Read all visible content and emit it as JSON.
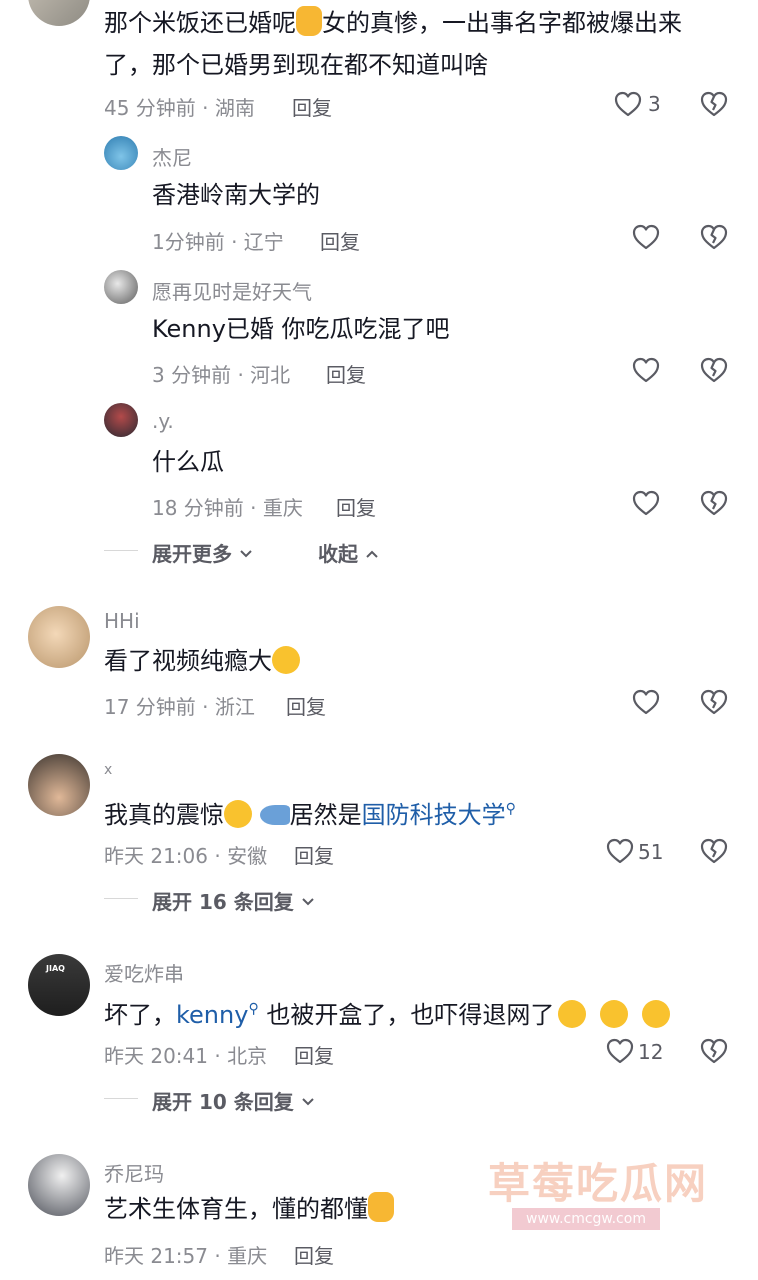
{
  "comments": [
    {
      "text_line1": "那个米饭还已婚呢",
      "text_line1b": "女的真惨，一出事名字都被爆出来",
      "text_line2": "了，那个已婚男到现在都不知道叫啥",
      "meta": "45 分钟前 · 湖南",
      "reply": "回复",
      "likes": "3"
    },
    {
      "name": "HHi",
      "text": "看了视频纯瘾大",
      "meta": "17 分钟前 · 浙江",
      "reply": "回复"
    },
    {
      "name": "x",
      "text_a": "我真的震惊",
      "text_b": "居然是",
      "link": "国防科技大学",
      "meta": "昨天 21:06 · 安徽",
      "reply": "回复",
      "likes": "51",
      "expand": "展开 16 条回复"
    },
    {
      "name": "爱吃炸串",
      "avatar_text": "JIAQ",
      "text_a": "坏了，",
      "link": "kenny",
      "text_b": " 也被开盒了，也吓得退网了",
      "meta": "昨天 20:41 · 北京",
      "reply": "回复",
      "likes": "12",
      "expand": "展开 10 条回复"
    },
    {
      "name": "乔尼玛",
      "text": "艺术生体育生，懂的都懂",
      "meta": "昨天 21:57 · 重庆",
      "reply": "回复"
    }
  ],
  "replies": [
    {
      "name": "杰尼",
      "text": "香港岭南大学的",
      "meta": "1分钟前 · 辽宁",
      "reply": "回复"
    },
    {
      "name": "愿再见时是好天气",
      "text": "Kenny已婚 你吃瓜吃混了吧",
      "meta": "3 分钟前 · 河北",
      "reply": "回复"
    },
    {
      "name": ".y.",
      "text": "什么瓜",
      "meta": "18 分钟前 · 重庆",
      "reply": "回复"
    }
  ],
  "thread_controls": {
    "expand_more": "展开更多",
    "collapse": "收起"
  },
  "watermark": {
    "title": "草莓吃瓜网",
    "url": "www.cmcgw.com"
  },
  "icons": {
    "like": "heart-outline-icon",
    "dislike": "broken-heart-icon"
  }
}
